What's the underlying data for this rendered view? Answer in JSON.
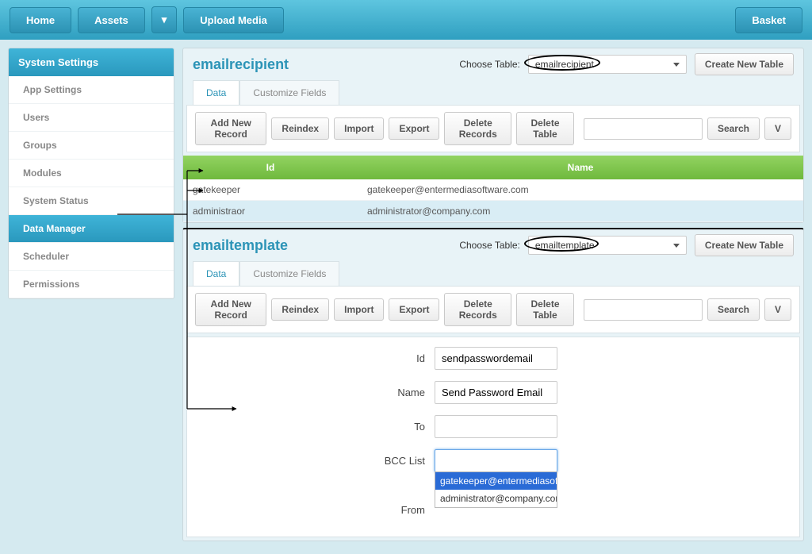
{
  "nav": {
    "home": "Home",
    "assets": "Assets",
    "upload": "Upload Media",
    "basket": "Basket"
  },
  "sidebar": {
    "header": "System Settings",
    "items": [
      {
        "label": "App Settings",
        "active": false
      },
      {
        "label": "Users",
        "active": false
      },
      {
        "label": "Groups",
        "active": false
      },
      {
        "label": "Modules",
        "active": false
      },
      {
        "label": "System Status",
        "active": false
      },
      {
        "label": "Data Manager",
        "active": true
      },
      {
        "label": "Scheduler",
        "active": false
      },
      {
        "label": "Permissions",
        "active": false
      }
    ]
  },
  "panel1": {
    "title": "emailrecipient",
    "choose_label": "Choose Table:",
    "choose_value": "emailrecipient",
    "create_btn": "Create New Table",
    "tabs": {
      "data": "Data",
      "customize": "Customize Fields"
    },
    "toolbar": {
      "add": "Add New Record",
      "reindex": "Reindex",
      "import": "Import",
      "export": "Export",
      "delete_records": "Delete Records",
      "delete_table": "Delete Table",
      "search": "Search",
      "v": "V"
    },
    "columns": {
      "id": "Id",
      "name": "Name"
    },
    "rows": [
      {
        "id": "gatekeeper",
        "name": "gatekeeper@entermediasoftware.com"
      },
      {
        "id": "administraor",
        "name": "administrator@company.com"
      }
    ]
  },
  "panel2": {
    "title": "emailtemplate",
    "choose_label": "Choose Table:",
    "choose_value": "emailtemplate",
    "create_btn": "Create New Table",
    "tabs": {
      "data": "Data",
      "customize": "Customize Fields"
    },
    "toolbar": {
      "add": "Add New Record",
      "reindex": "Reindex",
      "import": "Import",
      "export": "Export",
      "delete_records": "Delete Records",
      "delete_table": "Delete Table",
      "search": "Search",
      "v": "V"
    },
    "form": {
      "id_label": "Id",
      "id_value": "sendpasswordemail",
      "name_label": "Name",
      "name_value": "Send Password Email",
      "to_label": "To",
      "to_value": "",
      "bcc_label": "BCC List",
      "bcc_value": "",
      "from_label": "From",
      "dropdown": [
        {
          "label": "gatekeeper@entermediasoft",
          "selected": true
        },
        {
          "label": "administrator@company.com",
          "selected": false
        }
      ]
    }
  }
}
